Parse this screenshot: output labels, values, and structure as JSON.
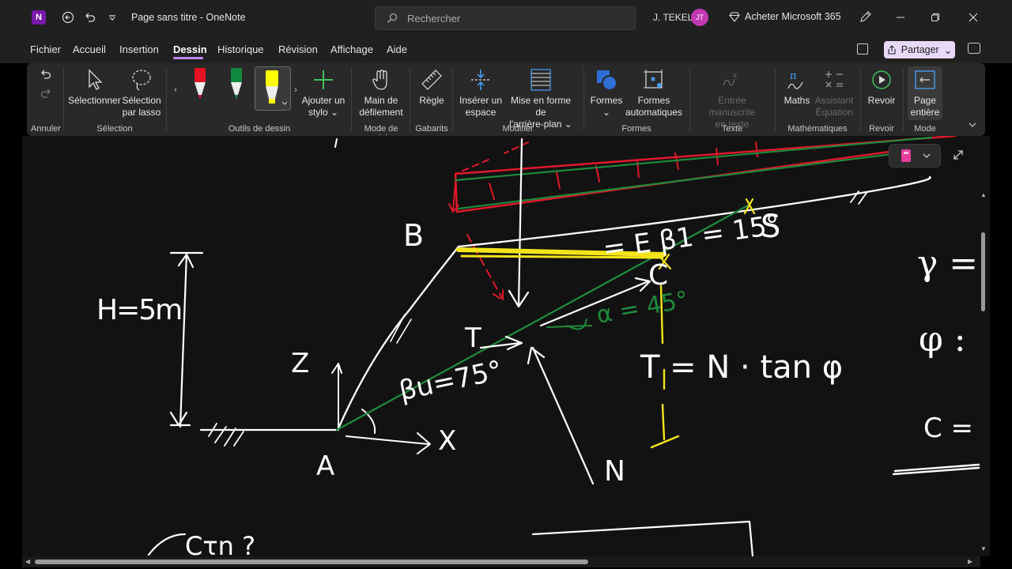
{
  "titlebar": {
    "app_icon": "N",
    "title": "Page sans titre  -  OneNote",
    "search_placeholder": "Rechercher",
    "user_name": "J. TEKEL",
    "user_initials": "JT",
    "buy_label": "Acheter Microsoft 365"
  },
  "menu": {
    "items": [
      "Fichier",
      "Accueil",
      "Insertion",
      "Dessin",
      "Historique",
      "Révision",
      "Affichage",
      "Aide"
    ],
    "active": "Dessin",
    "share_label": "Partager"
  },
  "ribbon": {
    "annuler_group": "Annuler",
    "select_label": "Sélectionner",
    "lasso_label_1": "Sélection",
    "lasso_label_2": "par lasso",
    "selection_group": "Sélection",
    "add_pen_1": "Ajouter un",
    "add_pen_2": "stylo ⌄",
    "tools_group": "Outils de dessin",
    "scroll_1": "Main de",
    "scroll_2": "défilement",
    "mode_saisie_group": "Mode de saisie",
    "ruler_label": "Règle",
    "gabarits_group": "Gabarits",
    "insert_space_1": "Insérer un",
    "insert_space_2": "espace",
    "background_1": "Mise en forme de",
    "background_2": "l'arrière-plan ⌄",
    "modifier_group": "Modifier",
    "shapes_label": "Formes",
    "shapes_arrow": "⌄",
    "auto_shapes_1": "Formes",
    "auto_shapes_2": "automatiques",
    "formes_group": "Formes",
    "ink_text_1": "Entrée manuscrite",
    "ink_text_2": "en texte",
    "texte_group": "Texte",
    "math_label": "Maths",
    "math_assist_1": "Assistant",
    "math_assist_2": "Équation",
    "math_group": "Mathématiques",
    "replay_label": "Revoir",
    "replay_group": "Revoir",
    "fullpage_1": "Page",
    "fullpage_2": "entière",
    "mode_group": "Mode"
  },
  "drawing": {
    "label_B": "B",
    "label_A": "A",
    "label_C": "C",
    "label_T": "T",
    "label_N": "N",
    "label_Z": "Z",
    "label_X": "X",
    "label_S": "S",
    "height": "H=5m",
    "beta_u": "βu=75°",
    "beta_1": "= E β1 = 15°",
    "alpha": "α = 45°",
    "formula": "T = N · tan φ",
    "right_gamma": "γ =",
    "right_phi": "φ :",
    "right_c": "C =",
    "bottom_text": "Cτn ?"
  },
  "colors": {
    "accent": "#c087f0",
    "share_bg": "#e8d9f8",
    "pen_red": "#e81123",
    "pen_green": "#10893e",
    "pen_yellow": "#ffff00",
    "ink_white": "#ffffff",
    "ink_red": "#e0182b",
    "ink_green": "#1e8a3c",
    "ink_yellow": "#f4e41a"
  }
}
